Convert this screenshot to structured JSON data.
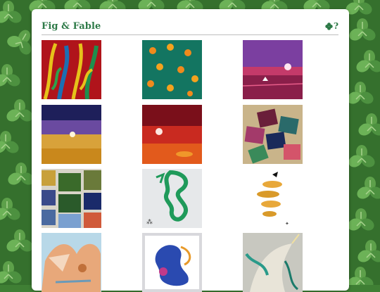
{
  "header": {
    "title": "Fig & Fable",
    "help_label": "?",
    "clover_icon": "four-leaf-clover-icon"
  },
  "colors": {
    "title_green": "#2e7a48",
    "card_bg": "#ffffff",
    "background_green": "#3f7f34"
  },
  "gallery": [
    {
      "name": "gallery-thumb-red-leaves-painting"
    },
    {
      "name": "gallery-thumb-orange-tree-painting"
    },
    {
      "name": "gallery-thumb-purple-sunset-boat-painting"
    },
    {
      "name": "gallery-thumb-golden-sky-painting"
    },
    {
      "name": "gallery-thumb-red-moon-painting"
    },
    {
      "name": "gallery-thumb-tiles-on-table-photo"
    },
    {
      "name": "gallery-thumb-wall-of-canvases-photo"
    },
    {
      "name": "gallery-thumb-green-dragon-drawing"
    },
    {
      "name": "gallery-thumb-fish-stack-drawing"
    },
    {
      "name": "gallery-thumb-winged-lion-painting"
    },
    {
      "name": "gallery-thumb-blue-dragon-framed"
    },
    {
      "name": "gallery-thumb-unicorn-painting"
    }
  ]
}
